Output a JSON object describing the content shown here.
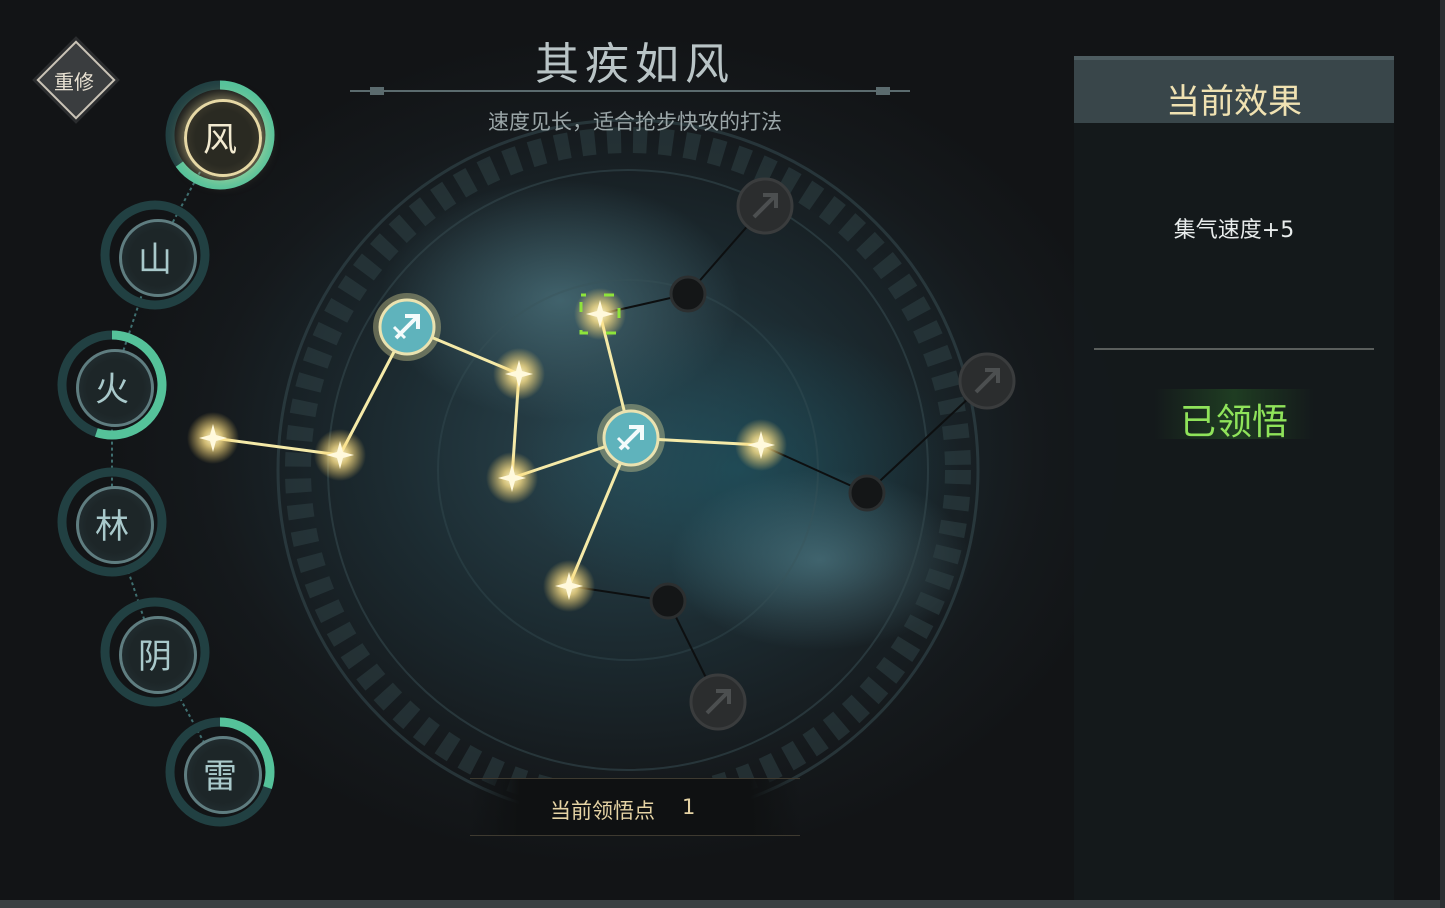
{
  "reset_button": {
    "label": "重修"
  },
  "elements": [
    {
      "key": "feng",
      "glyph": "风",
      "active": true,
      "progress": 0.65
    },
    {
      "key": "shan",
      "glyph": "山",
      "active": false,
      "progress": 0.0
    },
    {
      "key": "huo",
      "glyph": "火",
      "active": false,
      "progress": 0.55
    },
    {
      "key": "lin",
      "glyph": "林",
      "active": false,
      "progress": 0.0
    },
    {
      "key": "yin",
      "glyph": "阴",
      "active": false,
      "progress": 0.0
    },
    {
      "key": "lei",
      "glyph": "雷",
      "active": false,
      "progress": 0.3
    }
  ],
  "header": {
    "title": "其疾如风",
    "subtitle": "速度见长，适合抢步快攻的打法"
  },
  "points": {
    "label": "当前领悟点",
    "value": "1"
  },
  "effect_panel": {
    "title": "当前效果",
    "effect": "集气速度+5",
    "status": "已领悟"
  },
  "colors": {
    "lit_star": "#ffe9a0",
    "lit_link": "#f5eaa8",
    "skill_node": "#5fb3bc",
    "locked_node": "#2a2c2d",
    "selected_outline": "#8ee43b",
    "status_green": "#8fe35a",
    "gold_text": "#f0e2b2"
  }
}
